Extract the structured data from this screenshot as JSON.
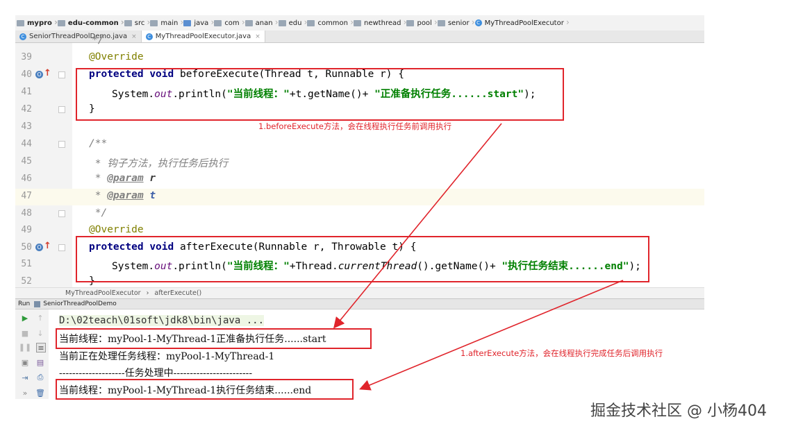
{
  "breadcrumb": [
    "mypro",
    "edu-common",
    "src",
    "main",
    "java",
    "com",
    "anan",
    "edu",
    "common",
    "newthread",
    "pool",
    "senior",
    "MyThreadPoolExecutor"
  ],
  "tabs": [
    {
      "label": "SeniorThreadPoolDemo.java",
      "close": "×"
    },
    {
      "label": "MyThreadPoolExecutor.java",
      "close": "×"
    }
  ],
  "editor": {
    "partial_top_line": "*/",
    "lines": {
      "l39": {
        "num": "39",
        "text": "@Override"
      },
      "l40": {
        "num": "40",
        "kw1": "protected",
        "kw2": "void",
        "rest": " beforeExecute(Thread t, Runnable r) {"
      },
      "l41": {
        "num": "41",
        "a": "System.",
        "fld": "out",
        "b": ".println(",
        "s1": "\"当前线程：\"",
        "c": "+t.getName()+ ",
        "s2": "\"正准备执行任务......start\"",
        "d": ");"
      },
      "l42": {
        "num": "42",
        "text": "}"
      },
      "l43": {
        "num": "43"
      },
      "l44": {
        "num": "44",
        "text": "/**"
      },
      "l45": {
        "num": "45",
        "text": " * 钩子方法，执行任务后执行"
      },
      "l46": {
        "num": "46",
        "star": " * ",
        "tag": "@param",
        "param": " r"
      },
      "l47": {
        "num": "47",
        "star": " * ",
        "tag": "@param",
        "param": " t"
      },
      "l48": {
        "num": "48",
        "text": " */"
      },
      "l49": {
        "num": "49",
        "text": "@Override"
      },
      "l50": {
        "num": "50",
        "kw1": "protected",
        "kw2": "void",
        "rest": " afterExecute(Runnable r, Throwable t) {"
      },
      "l51": {
        "num": "51",
        "a": "System.",
        "fld": "out",
        "b": ".println(",
        "s1": "\"当前线程：\"",
        "c": "+Thread.",
        "it": "currentThread",
        "c2": "().getName()+ ",
        "s2": "\"执行任务结束......end\"",
        "d": ");"
      },
      "l52": {
        "num": "52",
        "text": "}"
      }
    },
    "gutter_icon": "O"
  },
  "annotations": {
    "before": "1.beforeExecute方法，会在线程执行任务前调用执行",
    "after": "1.afterExecute方法，会在线程执行完成任务后调用执行",
    "accent": "#e0242b"
  },
  "statusbar": {
    "class": "MyThreadPoolExecutor",
    "sep": "›",
    "method": "afterExecute()"
  },
  "run": {
    "label": "Run",
    "config": "SeniorThreadPoolDemo",
    "console": [
      "D:\\02teach\\01soft\\jdk8\\bin\\java ...",
      "当前线程：myPool-1-MyThread-1正准备执行任务......start",
      "当前正在处理任务线程：myPool-1-MyThread-1",
      "--------------------任务处理中------------------------",
      "当前线程：myPool-1-MyThread-1执行任务结束......end"
    ]
  },
  "watermark": "掘金技术社区 @ 小杨404"
}
